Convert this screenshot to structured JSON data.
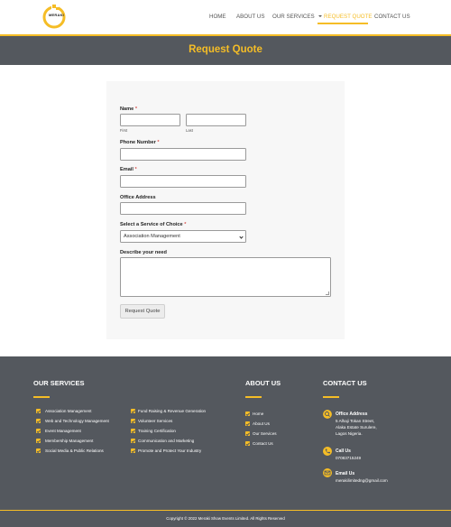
{
  "brand": {
    "logo_text": "MERAKI",
    "accent": "#f5bd26",
    "dark": "#54585e"
  },
  "nav": {
    "items": [
      {
        "label": "HOME"
      },
      {
        "label": "ABOUT US"
      },
      {
        "label": "OUR SERVICES"
      },
      {
        "label": "REQUEST QUOTE",
        "active": true
      },
      {
        "label": "CONTACT US"
      }
    ]
  },
  "page": {
    "title": "Request Quote"
  },
  "form": {
    "name_label": "Name",
    "required_mark": "*",
    "first_label": "First",
    "last_label": "Last",
    "phone_label": "Phone Number",
    "email_label": "Email",
    "office_label": "Office Address",
    "service_label": "Select a Service of Choice",
    "service_selected": "Association Management",
    "need_label": "Describe your need",
    "submit_label": "Request Quote"
  },
  "footer": {
    "services_heading": "OUR SERVICES",
    "services_col1": [
      "Association Management",
      "Web and Technology Management",
      "Event Management",
      "Membership Management",
      "Social Media & Public Relations"
    ],
    "services_col2": [
      "Fund Raising & Revenue Generation",
      "Volunteer Services",
      "Training Certification",
      "Communication and Marketing",
      "Promote and Protect Your Industry"
    ],
    "about_heading": "ABOUT US",
    "about_links": [
      "Home",
      "About Us",
      "Our Services",
      "Contact Us"
    ],
    "contact_heading": "CONTACT US",
    "office_title": "Office Address",
    "office_lines": [
      "5 Alhaji Tokan Street,",
      "Alaka Estate Surulere,",
      "Lagos Nigeria."
    ],
    "call_title": "Call Us",
    "call_number": "07083715249",
    "email_title": "Email Us",
    "email_address": "merakilimitedng@gmail.com",
    "copyright": "Copyright © 2022 Meraki Show Events Limited. All Rights Reserved"
  }
}
